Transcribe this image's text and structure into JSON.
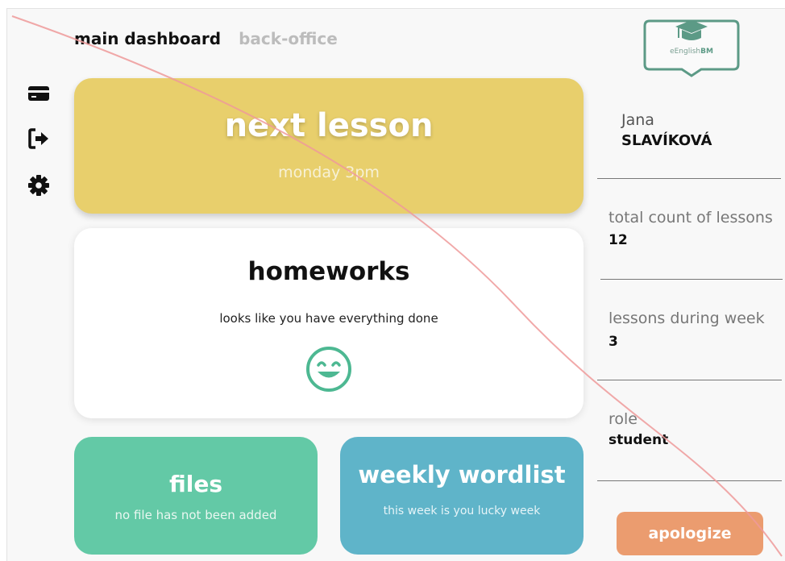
{
  "nav": {
    "main_dashboard": "main dashboard",
    "back_office": "back-office"
  },
  "sidebar": {
    "icons": [
      "credit-card-icon",
      "sign-out-icon",
      "gear-icon"
    ]
  },
  "next_lesson": {
    "title": "next lesson",
    "time": "monday 3pm"
  },
  "homeworks": {
    "title": "homeworks",
    "message": "looks like you have everything done",
    "icon": "smile-icon"
  },
  "files": {
    "title": "files",
    "message": "no file has not been added"
  },
  "wordlist": {
    "title": "weekly wordlist",
    "message": "this week is you lucky week"
  },
  "logo": {
    "text_prefix": "eEnglish",
    "text_suffix": "BM"
  },
  "user": {
    "first_name": "Jana",
    "last_name": "SLAVÍKOVÁ"
  },
  "stats": [
    {
      "label": "total count of lessons",
      "value": "12"
    },
    {
      "label": "lessons during week",
      "value": "3"
    },
    {
      "label": "role",
      "value": "student"
    }
  ],
  "actions": {
    "apologize": "apologize"
  },
  "colors": {
    "next_lesson": "#e8cf6c",
    "files": "#63c9a6",
    "wordlist": "#5fb4c9",
    "apologize": "#eb9c6f",
    "accent_green": "#4db892",
    "logo": "#5c9a86"
  }
}
